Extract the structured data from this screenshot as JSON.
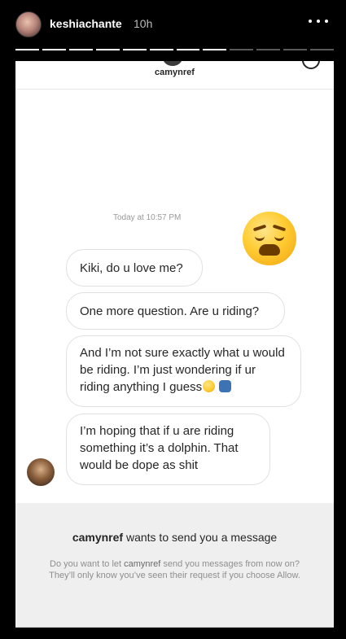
{
  "story": {
    "username": "keshiachante",
    "time": "10h",
    "progress": {
      "total": 12,
      "completed": 8
    }
  },
  "conversation": {
    "header_name": "camynref",
    "timestamp": "Today at 10:57 PM",
    "messages": [
      {
        "text": "Kiki, do u love me?"
      },
      {
        "text": "One more question. Are u riding?"
      },
      {
        "text": "And I’m not sure exactly what u would be riding. I’m just wondering if ur riding anything I guess",
        "emojis": [
          "thinking-face",
          "person-shrugging"
        ]
      },
      {
        "text": "I’m hoping that if u are riding something it’s a dolphin. That would be dope as shit"
      }
    ],
    "sticker": "weary-face-emoji"
  },
  "request": {
    "title_name": "camynref",
    "title_rest": " wants to send you a message",
    "desc_pre": "Do you want to let ",
    "desc_name": "camynref",
    "desc_post": " send you messages from now on? They’ll only know you’ve seen their request if you choose Allow."
  },
  "colors": {
    "background": "#000000",
    "panel": "#ffffff",
    "request_bg": "#efefef",
    "muted_text": "#8e8e8e"
  }
}
